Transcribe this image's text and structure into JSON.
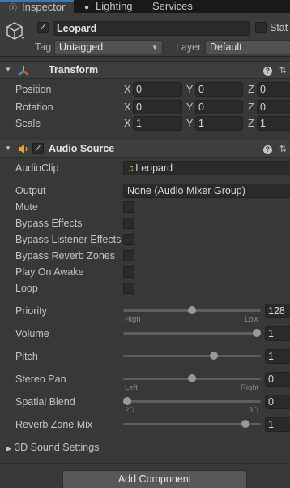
{
  "tabs": [
    {
      "label": "Inspector",
      "icon": "info-icon",
      "active": true
    },
    {
      "label": "Lighting",
      "icon": "bulb-icon",
      "active": false
    },
    {
      "label": "Services",
      "icon": "cloud-icon",
      "active": false
    }
  ],
  "header": {
    "object_name": "Leopard",
    "static_label": "Stat",
    "active_checked": true,
    "tag_label": "Tag",
    "tag_value": "Untagged",
    "layer_label": "Layer",
    "layer_value": "Default"
  },
  "transform": {
    "title": "Transform",
    "rows": [
      {
        "label": "Position",
        "x": "0",
        "y": "0",
        "z": "0"
      },
      {
        "label": "Rotation",
        "x": "0",
        "y": "0",
        "z": "0"
      },
      {
        "label": "Scale",
        "x": "1",
        "y": "1",
        "z": "1"
      }
    ],
    "axis_x": "X",
    "axis_y": "Y",
    "axis_z": "Z"
  },
  "audio_source": {
    "title": "Audio Source",
    "enabled": true,
    "audioclip_label": "AudioClip",
    "audioclip_value": "Leopard",
    "output_label": "Output",
    "output_value": "None (Audio Mixer Group)",
    "checkboxes": [
      {
        "label": "Mute",
        "checked": false
      },
      {
        "label": "Bypass Effects",
        "checked": false
      },
      {
        "label": "Bypass Listener Effects",
        "checked": false
      },
      {
        "label": "Bypass Reverb Zones",
        "checked": false
      },
      {
        "label": "Play On Awake",
        "checked": false
      },
      {
        "label": "Loop",
        "checked": false
      }
    ],
    "sliders": [
      {
        "label": "Priority",
        "value": "128",
        "fraction": 0.5,
        "min_caption": "High",
        "max_caption": "Low"
      },
      {
        "label": "Volume",
        "value": "1",
        "fraction": 1.0,
        "min_caption": "",
        "max_caption": ""
      },
      {
        "label": "Pitch",
        "value": "1",
        "fraction": 0.67,
        "min_caption": "",
        "max_caption": ""
      },
      {
        "label": "Stereo Pan",
        "value": "0",
        "fraction": 0.5,
        "min_caption": "Left",
        "max_caption": "Right"
      },
      {
        "label": "Spatial Blend",
        "value": "0",
        "fraction": 0.0,
        "min_caption": "2D",
        "max_caption": "3D"
      },
      {
        "label": "Reverb Zone Mix",
        "value": "1",
        "fraction": 0.91,
        "min_caption": "",
        "max_caption": ""
      }
    ],
    "sound_settings_label": "3D Sound Settings"
  },
  "footer": {
    "add_component_label": "Add Component"
  },
  "colors": {
    "background": "#383838",
    "tab_active_accent": "#3a79bb",
    "audio_icon": "#e9a32e",
    "clip_icon": "#e9b840"
  }
}
